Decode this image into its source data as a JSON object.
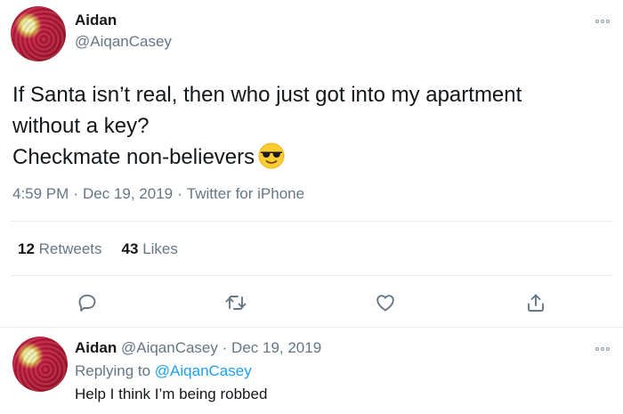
{
  "tweet": {
    "author": {
      "name": "Aidan",
      "handle": "@AiqanCasey"
    },
    "text_lines": [
      "If Santa isn’t real, then who just got into my apartment",
      "without a key?",
      "Checkmate non-believers"
    ],
    "emoji": "smiling-face-with-sunglasses",
    "time": "4:59 PM",
    "date": "Dec 19, 2019",
    "source": "Twitter for iPhone",
    "separator": "·",
    "stats": {
      "retweets_count": "12",
      "retweets_label": "Retweets",
      "likes_count": "43",
      "likes_label": "Likes"
    },
    "actions": [
      "reply-icon",
      "retweet-icon",
      "like-icon",
      "share-icon"
    ]
  },
  "reply": {
    "author": {
      "name": "Aidan",
      "handle": "@AiqanCasey"
    },
    "separator": "·",
    "date": "Dec 19, 2019",
    "replying_to_label": "Replying to",
    "replying_to_handle": "@AiqanCasey",
    "text": "Help I think I’m being robbed"
  },
  "colors": {
    "text": "#14171a",
    "secondary": "#657786",
    "link": "#1da1f2",
    "divider": "#e6ecf0",
    "icon": "#657786"
  }
}
